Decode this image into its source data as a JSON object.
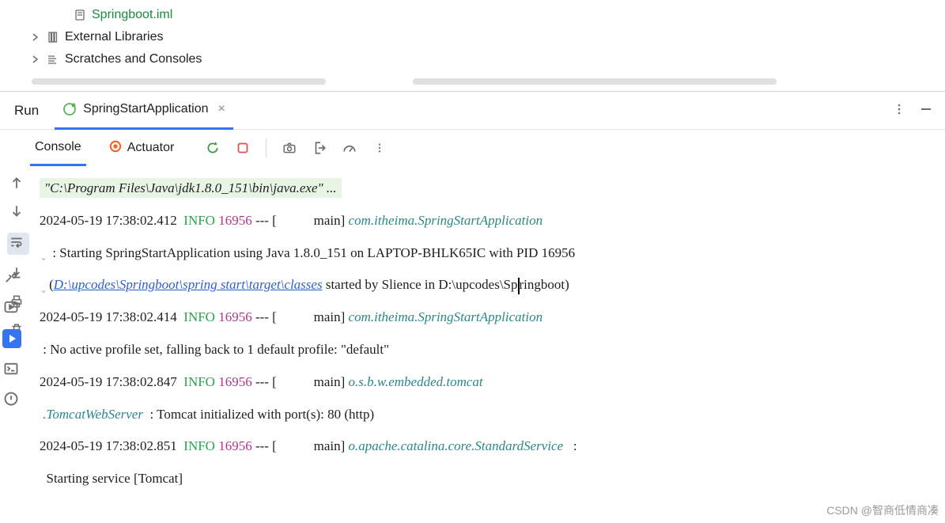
{
  "tree": {
    "file": "Springboot.iml",
    "ext_libs": "External Libraries",
    "scratches": "Scratches and Consoles"
  },
  "run": {
    "title": "Run",
    "tab_label": "SpringStartApplication",
    "sub_console": "Console",
    "sub_actuator": "Actuator"
  },
  "console": {
    "cmd": "\"C:\\Program Files\\Java\\jdk1.8.0_151\\bin\\java.exe\" ...",
    "lines": [
      {
        "ts": "2024-05-19 17:38:02.412",
        "lvl": "INFO",
        "pid": "16956",
        "thr": "main",
        "logger": "com.itheima.SpringStartApplication"
      },
      {
        "msg_pre": " : Starting SpringStartApplication using Java 1.8.0_151 on LAPTOP-BHLK65IC with PID 16956 ",
        "link": "D:\\upcodes\\Springboot\\spring start\\target\\classes",
        "msg_post": " started by Slience in D:\\upcodes\\Sp",
        "msg_tail": "ringboot)"
      },
      {
        "ts": "2024-05-19 17:38:02.414",
        "lvl": "INFO",
        "pid": "16956",
        "thr": "main",
        "logger": "com.itheima.SpringStartApplication"
      },
      {
        "msg": " : No active profile set, falling back to 1 default profile: \"default\""
      },
      {
        "ts": "2024-05-19 17:38:02.847",
        "lvl": "INFO",
        "pid": "16956",
        "thr": "main",
        "logger": "o.s.b.w.embedded.tomcat"
      },
      {
        "msg_cont": ".TomcatWebServer",
        "msg": "  : Tomcat initialized with port(s): 80 (http)"
      },
      {
        "ts": "2024-05-19 17:38:02.851",
        "lvl": "INFO",
        "pid": "16956",
        "thr": "main",
        "logger": "o.apache.catalina.core.StandardService",
        "tail_colon": "   :"
      },
      {
        "msg_partial": "  Starting service [Tomcat]"
      }
    ]
  },
  "watermark": "CSDN @智商低情商凑"
}
